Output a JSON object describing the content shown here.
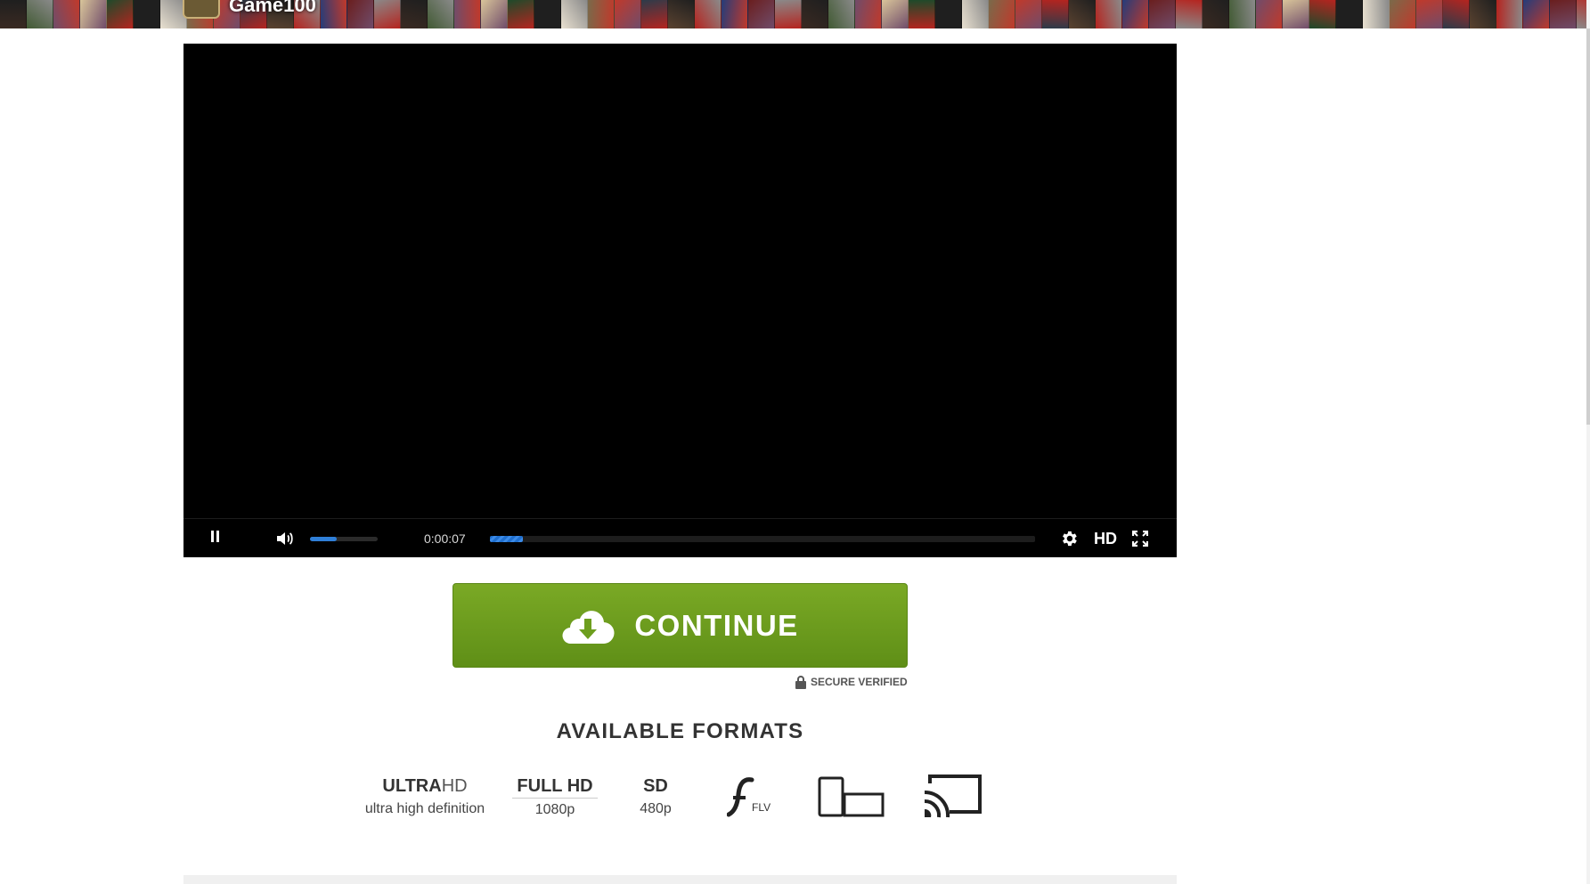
{
  "header": {
    "site_name": "Game100"
  },
  "player": {
    "time": "0:00:07",
    "quality_label": "HD",
    "volume": 0.4,
    "progress": 0.06,
    "accent_color": "#2f7fd8"
  },
  "cta": {
    "continue_label": "CONTINUE",
    "secure_label": "SECURE VERIFIED",
    "button_color": "#6d9e1e"
  },
  "formats": {
    "title": "AVAILABLE FORMATS",
    "items": [
      {
        "main_bold": "ULTRA",
        "main_light": "HD",
        "sub": "ultra high definition"
      },
      {
        "main_bold": "FULL HD",
        "sub": "1080p"
      },
      {
        "main_bold": "SD",
        "sub": "480p"
      }
    ],
    "flv_label": "FLV"
  }
}
